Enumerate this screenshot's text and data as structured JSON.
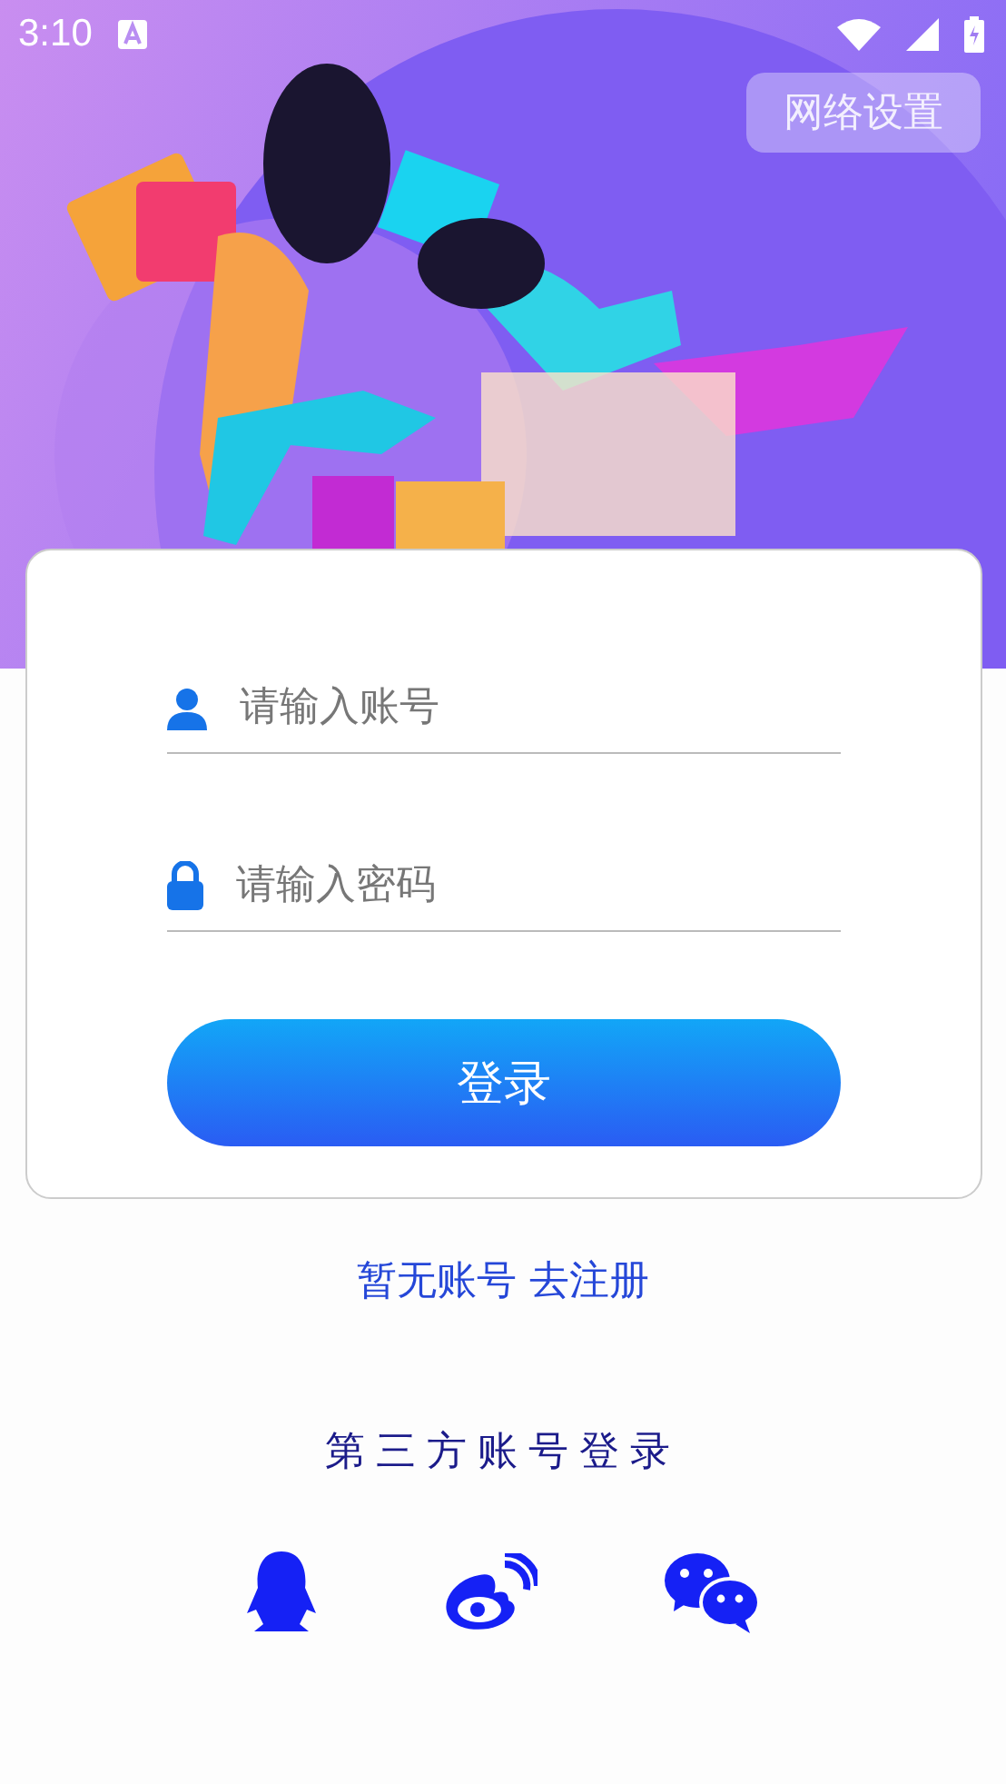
{
  "status_bar": {
    "time": "3:10"
  },
  "network_button": {
    "label": "网络设置"
  },
  "login_form": {
    "fields": [
      {
        "kind": "account",
        "placeholder": "请输入账号"
      },
      {
        "kind": "password",
        "placeholder": "请输入密码"
      }
    ],
    "submit": "登录"
  },
  "register_link": "暂无账号 去注册",
  "third_party": {
    "title": "第三方账号登录",
    "providers": [
      {
        "kind": "qq"
      },
      {
        "kind": "weibo"
      },
      {
        "kind": "wechat"
      }
    ]
  }
}
